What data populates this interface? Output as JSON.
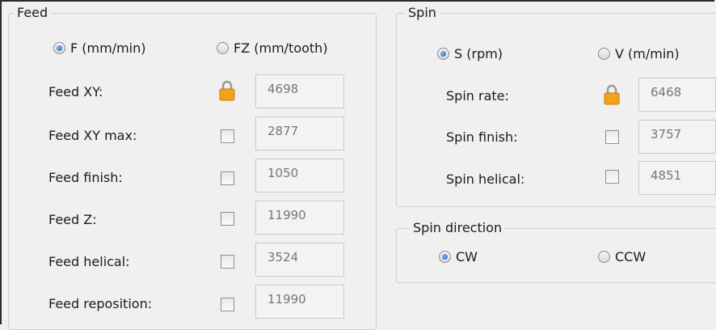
{
  "feed": {
    "title": "Feed",
    "mode_f": "F (mm/min)",
    "mode_fz": "FZ (mm/tooth)",
    "rows": [
      {
        "label": "Feed XY:",
        "value": "4698",
        "locked": true
      },
      {
        "label": "Feed XY max:",
        "value": "2877",
        "locked": false
      },
      {
        "label": "Feed finish:",
        "value": "1050",
        "locked": false
      },
      {
        "label": "Feed Z:",
        "value": "11990",
        "locked": false
      },
      {
        "label": "Feed helical:",
        "value": "3524",
        "locked": false
      },
      {
        "label": "Feed reposition:",
        "value": "11990",
        "locked": false
      }
    ]
  },
  "spin": {
    "title": "Spin",
    "mode_s": "S (rpm)",
    "mode_v": "V (m/min)",
    "rows": [
      {
        "label": "Spin rate:",
        "value": "6468",
        "locked": true
      },
      {
        "label": "Spin finish:",
        "value": "3757",
        "locked": false
      },
      {
        "label": "Spin helical:",
        "value": "4851",
        "locked": false
      }
    ]
  },
  "spin_direction": {
    "title": "Spin direction",
    "cw": "CW",
    "ccw": "CCW"
  },
  "icons": {
    "lock": "padlock-icon",
    "lock_color": "#f2a21b"
  }
}
